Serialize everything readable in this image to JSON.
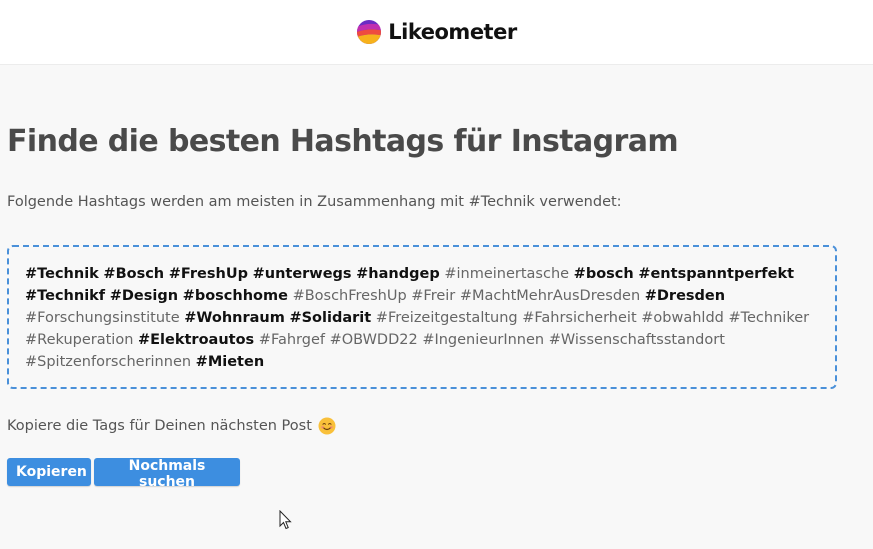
{
  "header": {
    "brand": "Likeometer",
    "logo_icon": "likeometer-logo-icon"
  },
  "main": {
    "title": "Finde die besten Hashtags für Instagram",
    "intro": "Folgende Hashtags werden am meisten in Zusammenhang mit #Technik verwendet:",
    "tags": [
      {
        "text": "#Technik",
        "strong": true
      },
      {
        "text": "#Bosch",
        "strong": true
      },
      {
        "text": "#FreshUp",
        "strong": true
      },
      {
        "text": "#unterwegs",
        "strong": true
      },
      {
        "text": "#handgep",
        "strong": true
      },
      {
        "text": "#inmeinertasche",
        "strong": false
      },
      {
        "text": "#bosch",
        "strong": true
      },
      {
        "text": "#entspanntperfekt",
        "strong": true
      },
      {
        "text": "#Technikf",
        "strong": true
      },
      {
        "text": "#Design",
        "strong": true
      },
      {
        "text": "#boschhome",
        "strong": true
      },
      {
        "text": "#BoschFreshUp",
        "strong": false
      },
      {
        "text": "#Freir",
        "strong": false
      },
      {
        "text": "#MachtMehrAusDresden",
        "strong": false
      },
      {
        "text": "#Dresden",
        "strong": true
      },
      {
        "text": "#Forschungsinstitute",
        "strong": false
      },
      {
        "text": "#Wohnraum",
        "strong": true
      },
      {
        "text": "#Solidarit",
        "strong": true
      },
      {
        "text": "#Freizeitgestaltung",
        "strong": false
      },
      {
        "text": "#Fahrsicherheit",
        "strong": false
      },
      {
        "text": "#obwahldd",
        "strong": false
      },
      {
        "text": "#Techniker",
        "strong": false
      },
      {
        "text": "#Rekuperation",
        "strong": false
      },
      {
        "text": "#Elektroautos",
        "strong": true
      },
      {
        "text": "#Fahrgef",
        "strong": false
      },
      {
        "text": "#OBWDD22",
        "strong": false
      },
      {
        "text": "#IngenieurInnen",
        "strong": false
      },
      {
        "text": "#Wissenschaftsstandort",
        "strong": false
      },
      {
        "text": "#Spitzenforscherinnen",
        "strong": false
      },
      {
        "text": "#Mieten",
        "strong": true
      }
    ],
    "copy_hint": "Kopiere die Tags für Deinen nächsten Post",
    "copy_hint_icon": "smiling-face-emoji-icon",
    "buttons": {
      "copy": "Kopieren",
      "search_again": "Nochmals suchen"
    }
  },
  "colors": {
    "accent": "#3d8ee0",
    "border": "#4a90d9",
    "strong_tag": "#111111",
    "weak_tag": "#666666"
  }
}
